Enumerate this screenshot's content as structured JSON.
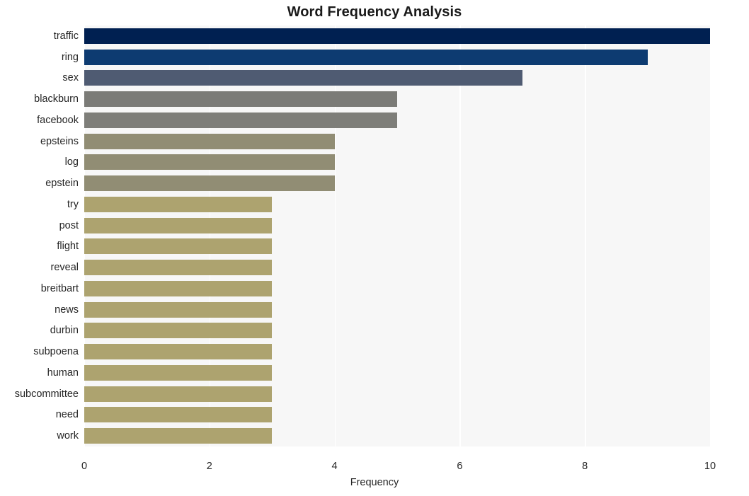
{
  "chart_data": {
    "type": "bar",
    "orientation": "horizontal",
    "title": "Word Frequency Analysis",
    "xlabel": "Frequency",
    "ylabel": "",
    "xlim": [
      0,
      10
    ],
    "ylim": [
      0,
      20
    ],
    "grid": true,
    "legend": null,
    "xticks": [
      "0",
      "2",
      "4",
      "6",
      "8",
      "10"
    ],
    "xtick_values": [
      0,
      2,
      4,
      6,
      8,
      10
    ],
    "categories": [
      "traffic",
      "ring",
      "sex",
      "blackburn",
      "facebook",
      "epsteins",
      "log",
      "epstein",
      "try",
      "post",
      "flight",
      "reveal",
      "breitbart",
      "news",
      "durbin",
      "subpoena",
      "human",
      "subcommittee",
      "need",
      "work"
    ],
    "values": [
      10,
      9,
      7,
      5,
      5,
      4,
      4,
      4,
      3,
      3,
      3,
      3,
      3,
      3,
      3,
      3,
      3,
      3,
      3,
      3
    ],
    "bar_colors": [
      "#002051",
      "#0d3b71",
      "#4f5b72",
      "#7b7b77",
      "#7e7e79",
      "#918d74",
      "#918d74",
      "#918d74",
      "#ada36f",
      "#ada36f",
      "#ada36f",
      "#ada36f",
      "#ada36f",
      "#ada36f",
      "#ada36f",
      "#ada36f",
      "#ada36f",
      "#ada36f",
      "#ada36f",
      "#ada36f"
    ],
    "colormap": "cividis",
    "plot_background": "#f7f7f7",
    "gridline_color": "#ffffff",
    "figure_background": "#ffffff"
  }
}
